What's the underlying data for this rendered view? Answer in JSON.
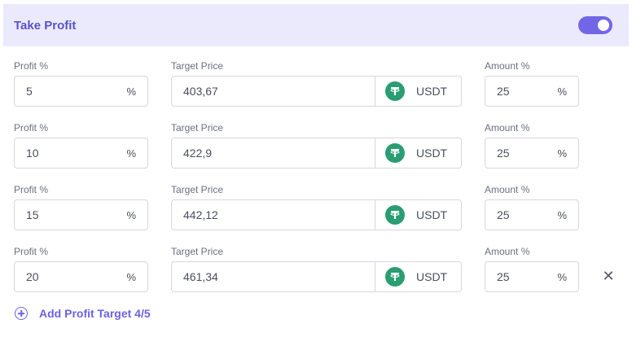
{
  "header": {
    "title": "Take Profit",
    "toggle_on": true
  },
  "labels": {
    "profit": "Profit %",
    "target_price": "Target Price",
    "amount": "Amount %"
  },
  "suffixes": {
    "percent": "%",
    "currency": "USDT"
  },
  "targets": [
    {
      "profit": "5",
      "target_price": "403,67",
      "amount": "25"
    },
    {
      "profit": "10",
      "target_price": "422,9",
      "amount": "25"
    },
    {
      "profit": "15",
      "target_price": "442,12",
      "amount": "25"
    },
    {
      "profit": "20",
      "target_price": "461,34",
      "amount": "25"
    }
  ],
  "add_target": {
    "label": "Add Profit Target 4/5"
  },
  "colors": {
    "accent": "#6c62e0",
    "header_bg": "#ebeafd",
    "usdt": "#2a9d72"
  }
}
